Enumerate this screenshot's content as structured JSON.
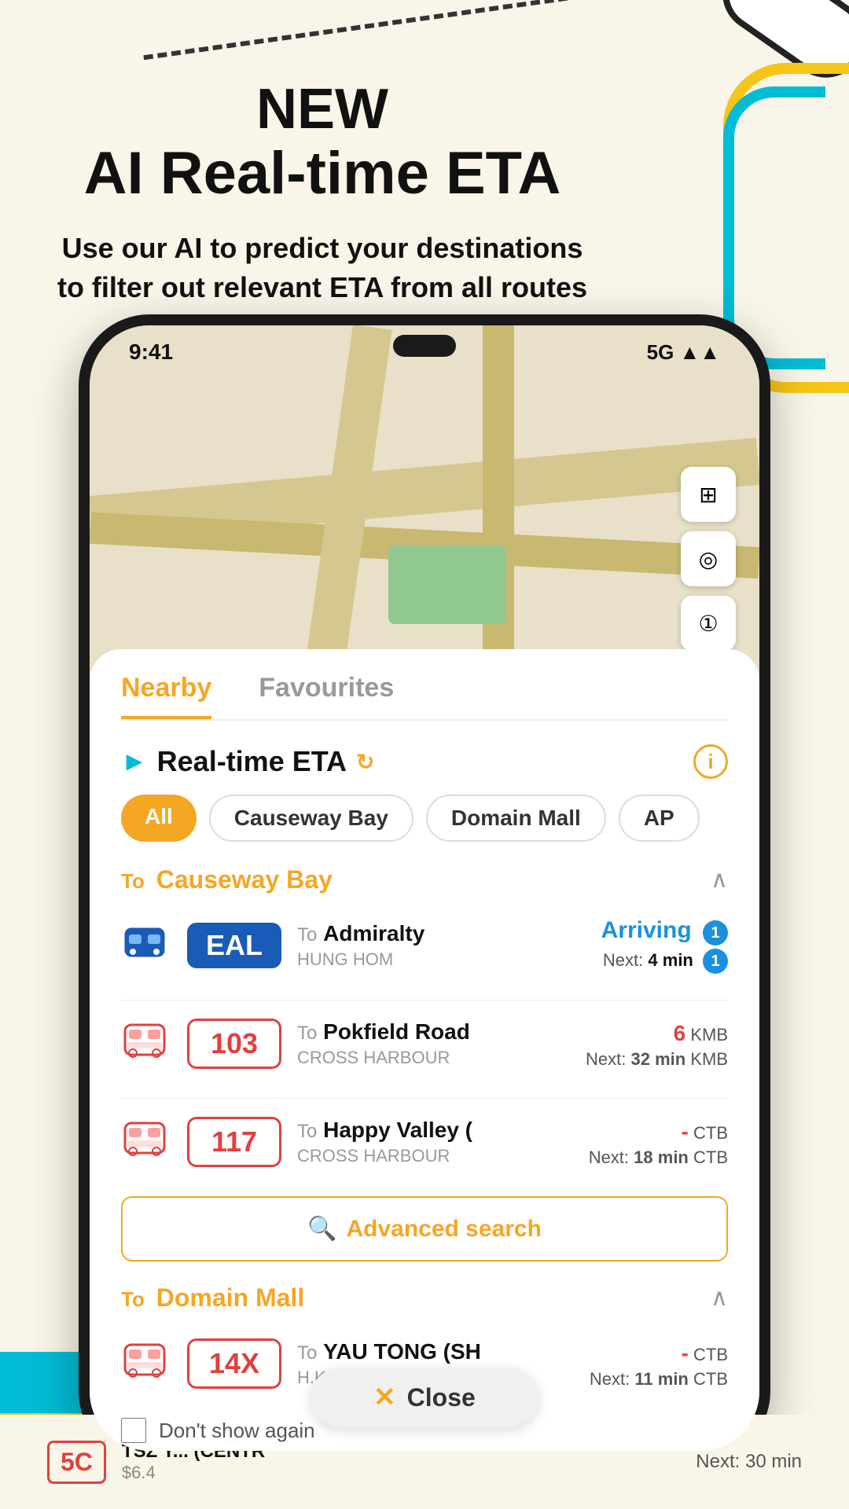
{
  "page": {
    "background_color": "#f9f5e8"
  },
  "header": {
    "new_label": "NEW",
    "title": "AI Real-time ETA",
    "subtitle": "Use our AI to predict your destinations to filter out relevant ETA from all routes"
  },
  "status_bar": {
    "time": "9:41",
    "signal": "5G",
    "signal_icon": "▲▲"
  },
  "tabs": [
    {
      "label": "Nearby",
      "active": true
    },
    {
      "label": "Favourites",
      "active": false
    }
  ],
  "eta_section": {
    "title": "Real-time ETA",
    "refresh_icon": "↻",
    "info_icon": "i"
  },
  "filter_chips": [
    {
      "label": "All",
      "active": true
    },
    {
      "label": "Causeway Bay",
      "active": false
    },
    {
      "label": "Domain Mall",
      "active": false
    },
    {
      "label": "AP",
      "active": false
    }
  ],
  "causeway_bay": {
    "section_title": "Causeway Bay",
    "to_label": "To",
    "routes": [
      {
        "route_number": "EAL",
        "route_style": "blue",
        "to": "To",
        "destination": "Admiralty",
        "via": "Hung Hom",
        "eta_label": "Arriving",
        "eta_badge1": "1",
        "next_label": "Next:",
        "next_time": "4 min",
        "next_badge": "1"
      },
      {
        "route_number": "103",
        "route_style": "red",
        "to": "To",
        "destination": "Pokfield Road",
        "eta_mins": "6",
        "eta_operator": "KMB",
        "via": "CROSS HARBOUR",
        "next_label": "Next:",
        "next_time": "32 min",
        "next_operator": "KMB"
      },
      {
        "route_number": "117",
        "route_style": "red",
        "to": "To",
        "destination": "Happy Valley (",
        "eta_mins": "-",
        "eta_operator": "CTB",
        "via": "CROSS HARBOUR",
        "next_label": "Next:",
        "next_time": "18 min",
        "next_operator": "CTB"
      }
    ]
  },
  "advanced_search": {
    "label": "Advanced search",
    "search_icon": "🔍"
  },
  "domain_mall": {
    "section_title": "Domain Mall",
    "to_label": "To",
    "routes": [
      {
        "route_number": "14X",
        "route_style": "red",
        "to": "To",
        "destination": "YAU TONG (SH",
        "eta_mins": "-",
        "eta_operator": "CTB",
        "via": "H.K. POLYTECH NI...",
        "next_label": "Next:",
        "next_time": "11 min",
        "next_operator": "CTB"
      }
    ]
  },
  "dont_show": "Don't show again",
  "close_button": {
    "label": "Close",
    "icon": "✕"
  },
  "bottom_routes": [
    {
      "route_number": "5C",
      "destination": "TSZ Y... (CENTR",
      "price": "$6.4",
      "next_time": "Next: 30 min"
    }
  ]
}
